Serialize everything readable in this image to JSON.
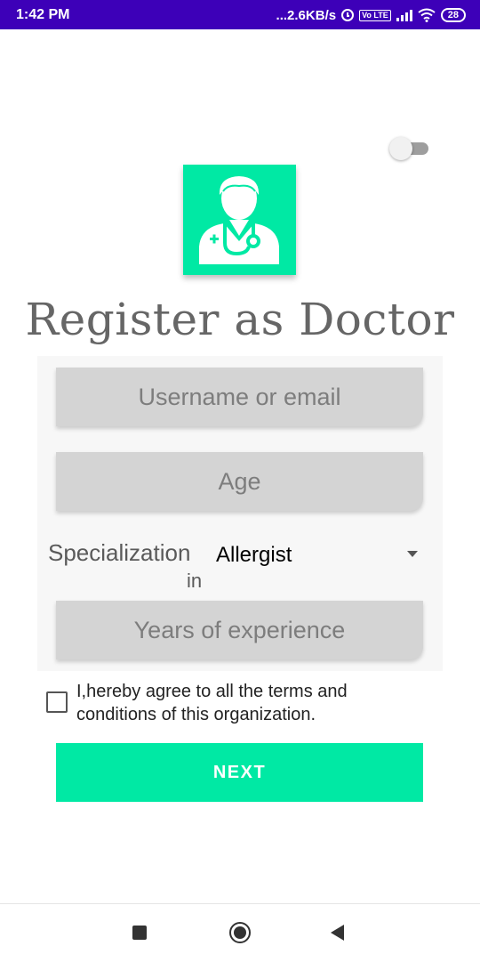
{
  "status_bar": {
    "time": "1:42 PM",
    "network_speed": "...2.6KB/s",
    "volte": "Vo LTE",
    "battery": "28"
  },
  "toggle": {
    "state": "off"
  },
  "logo": {
    "icon": "doctor-icon",
    "color": "#00e9a4"
  },
  "title": "Register as Doctor",
  "form": {
    "username_placeholder": "Username or email",
    "age_placeholder": "Age",
    "specialization_label_1": "Specialization",
    "specialization_label_2": "in",
    "specialization_value": "Allergist",
    "experience_placeholder": "Years of experience"
  },
  "terms": {
    "checked": false,
    "text": "I,hereby agree to all the terms and conditions of this organization."
  },
  "next_button": "NEXT",
  "nav_bar": {
    "recents": "square-icon",
    "home": "circle-icon",
    "back": "back-triangle-icon"
  },
  "colors": {
    "status_bar": "#3d00b8",
    "accent": "#00e9a4",
    "field_bg": "#d4d4d4"
  }
}
